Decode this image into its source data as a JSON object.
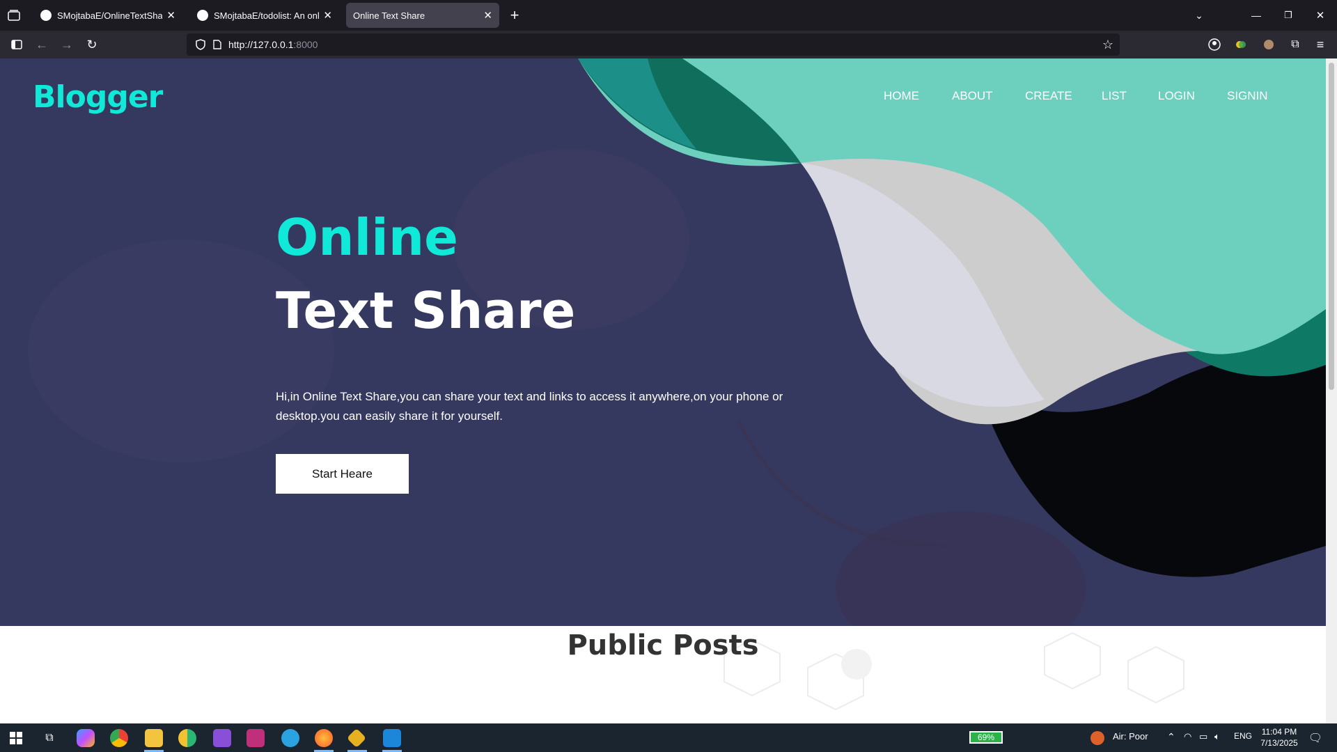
{
  "browser": {
    "tabs": [
      {
        "title": "SMojtabaE/OnlineTextShare: A"
      },
      {
        "title": "SMojtabaE/todolist: An online T"
      },
      {
        "title": "Online Text Share"
      }
    ],
    "url_host": "http://127.0.0.1",
    "url_port": ":8000"
  },
  "site": {
    "logo": "Blogger",
    "nav": [
      "HOME",
      "ABOUT",
      "CREATE",
      "LIST",
      "LOGIN",
      "SIGNIN"
    ],
    "hero_title_1": "Online",
    "hero_title_2": "Text Share",
    "hero_desc": "Hi,in Online Text Share,you can share your text and links to access it anywhere,on your phone or desktop.you can easily share it for yourself.",
    "cta_label": "Start Heare",
    "section_title": "Public Posts"
  },
  "taskbar": {
    "battery": "69%",
    "weather": "Air: Poor",
    "lang": "ENG",
    "time": "11:04 PM",
    "date": "7/13/2025"
  },
  "colors": {
    "accent": "#10e8d8",
    "hero_bg": "#36395f",
    "wave_teal": "#6dd0be",
    "wave_dark_teal": "#0e7a66",
    "wave_grey": "#cfcfcf"
  }
}
